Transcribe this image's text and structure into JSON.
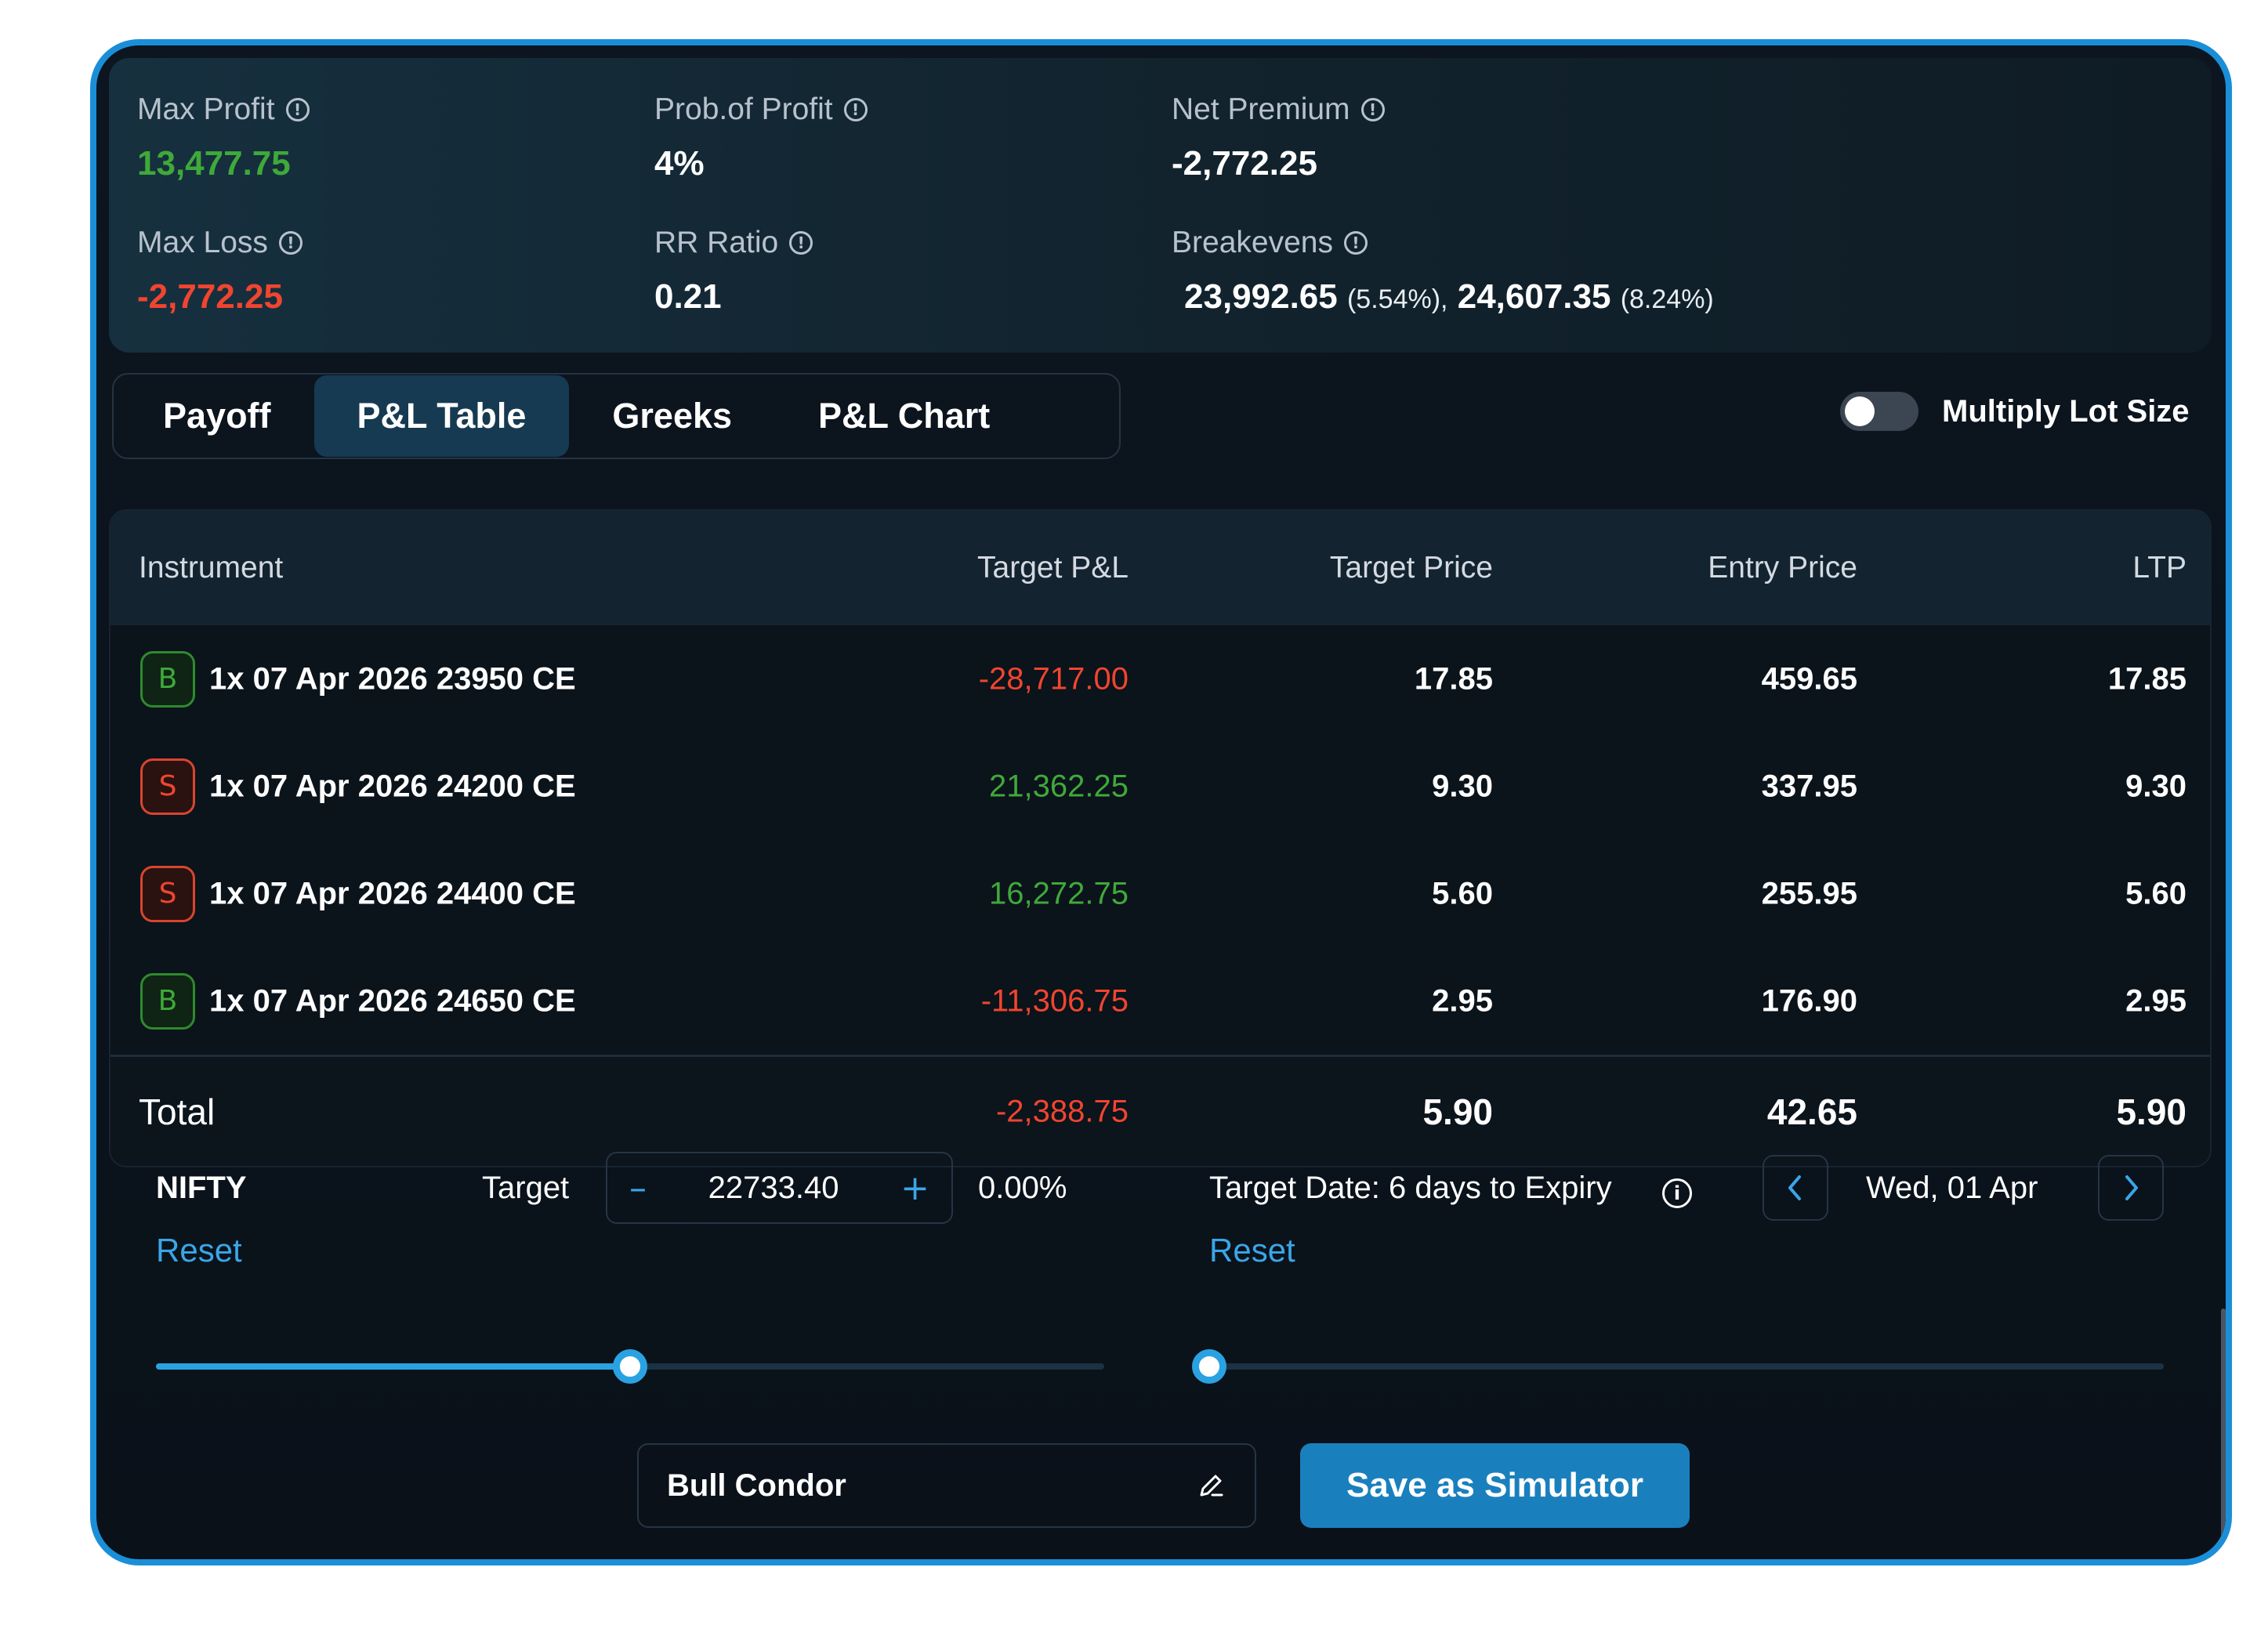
{
  "summary": {
    "max_profit_label": "Max Profit",
    "max_profit_value": "13,477.75",
    "prob_profit_label": "Prob.of Profit",
    "prob_profit_value": "4%",
    "net_premium_label": "Net Premium",
    "net_premium_value": "-2,772.25",
    "max_loss_label": "Max Loss",
    "max_loss_value": "-2,772.25",
    "rr_ratio_label": "RR Ratio",
    "rr_ratio_value": "0.21",
    "breakevens_label": "Breakevens",
    "breakeven_1": "23,992.65",
    "breakeven_1_pct": "(5.54%),",
    "breakeven_2": "24,607.35",
    "breakeven_2_pct": "(8.24%)"
  },
  "tabs": [
    {
      "label": "Payoff",
      "active": false
    },
    {
      "label": "P&L Table",
      "active": true
    },
    {
      "label": "Greeks",
      "active": false
    },
    {
      "label": "P&L Chart",
      "active": false
    }
  ],
  "multiply_lot_size": {
    "label": "Multiply Lot Size",
    "enabled": false
  },
  "table": {
    "headers": [
      "Instrument",
      "Target P&L",
      "Target Price",
      "Entry Price",
      "LTP"
    ],
    "rows": [
      {
        "side": "B",
        "instrument": "1x 07 Apr 2026 23950 CE",
        "target_pl": "-28,717.00",
        "target_price": "17.85",
        "entry_price": "459.65",
        "ltp": "17.85"
      },
      {
        "side": "S",
        "instrument": "1x 07 Apr 2026 24200 CE",
        "target_pl": "21,362.25",
        "target_price": "9.30",
        "entry_price": "337.95",
        "ltp": "9.30"
      },
      {
        "side": "S",
        "instrument": "1x 07 Apr 2026 24400 CE",
        "target_pl": "16,272.75",
        "target_price": "5.60",
        "entry_price": "255.95",
        "ltp": "5.60"
      },
      {
        "side": "B",
        "instrument": "1x 07 Apr 2026 24650 CE",
        "target_pl": "-11,306.75",
        "target_price": "2.95",
        "entry_price": "176.90",
        "ltp": "2.95"
      }
    ],
    "total": {
      "label": "Total",
      "target_pl": "-2,388.75",
      "target_price": "5.90",
      "entry_price": "42.65",
      "ltp": "5.90"
    }
  },
  "controls": {
    "symbol": "NIFTY",
    "target_label": "Target",
    "minus": "–",
    "plus": "+",
    "target_value": "22733.40",
    "target_change": "0.00%",
    "reset_label": "Reset",
    "price_slider_fraction": 0.5,
    "target_date_label": "Target Date: 6 days to Expiry",
    "date_value": "Wed, 01 Apr",
    "date_slider_fraction": 0.0
  },
  "strategy_name": "Bull Condor",
  "save_button": "Save as Simulator",
  "colors": {
    "accent": "#2aa2e2",
    "profit": "#3fa93a",
    "loss": "#f0452f",
    "frame_border": "#1a8fd8"
  }
}
